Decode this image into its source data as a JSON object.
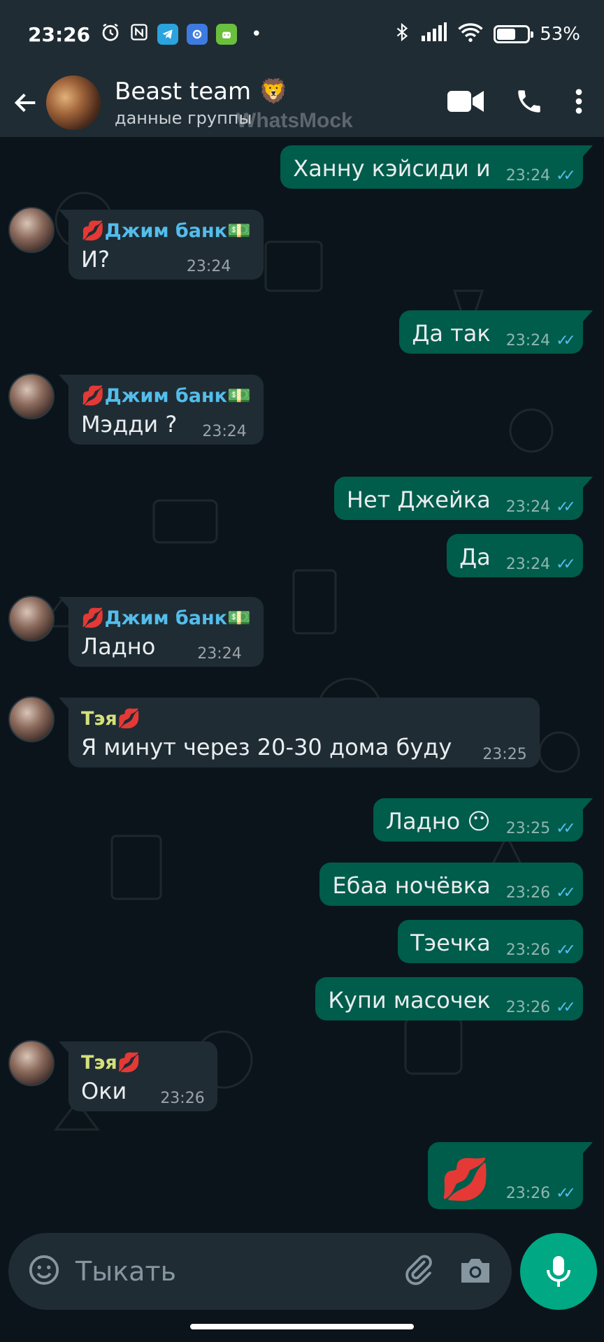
{
  "status_bar": {
    "time": "23:26",
    "battery": "53%",
    "battery_level": 0.53,
    "icons": [
      "alarm-icon",
      "nfc-icon",
      "telegram-icon",
      "settings-app-icon",
      "android-app-icon",
      "dot-icon",
      "bluetooth-icon",
      "signal-icon",
      "wifi-icon",
      "battery-icon"
    ]
  },
  "header": {
    "title": "Beast team 🦁",
    "subtitle": "данные группы",
    "watermark": "WhatsMock"
  },
  "messages": [
    {
      "dir": "out",
      "text": "Ханну кэйсиди и",
      "time": "23:24"
    },
    {
      "dir": "in",
      "sender": "💋Джим банк💵",
      "sender_color": "#53bdeb",
      "text": "И?",
      "time": "23:24"
    },
    {
      "dir": "out",
      "text": "Да так",
      "time": "23:24"
    },
    {
      "dir": "in",
      "sender": "💋Джим банк💵",
      "sender_color": "#53bdeb",
      "text": "Мэдди ?",
      "time": "23:24"
    },
    {
      "dir": "out",
      "text": "Нет Джейка",
      "time": "23:24"
    },
    {
      "dir": "out",
      "text": "Да",
      "time": "23:24"
    },
    {
      "dir": "in",
      "sender": "💋Джим банк💵",
      "sender_color": "#53bdeb",
      "text": "Ладно",
      "time": "23:24"
    },
    {
      "dir": "in",
      "sender": "Тэя💋",
      "sender_color": "#d4e07a",
      "text": "Я минут через 20-30 дома буду",
      "time": "23:25"
    },
    {
      "dir": "out",
      "text": "Ладно 😶",
      "time": "23:25"
    },
    {
      "dir": "out",
      "text": "Ебаа ночёвка",
      "time": "23:26"
    },
    {
      "dir": "out",
      "text": "Тэечка",
      "time": "23:26"
    },
    {
      "dir": "out",
      "text": "Купи масочек",
      "time": "23:26"
    },
    {
      "dir": "in",
      "sender": "Тэя💋",
      "sender_color": "#d4e07a",
      "text": "Оки",
      "time": "23:26"
    },
    {
      "dir": "out",
      "text": "💋",
      "time": "23:26"
    }
  ],
  "composer": {
    "placeholder": "Тыкать"
  },
  "colors": {
    "outgoing_bubble": "#005c4b",
    "incoming_bubble": "#1f2c34",
    "read_ticks": "#53bdeb",
    "accent": "#00a884"
  }
}
